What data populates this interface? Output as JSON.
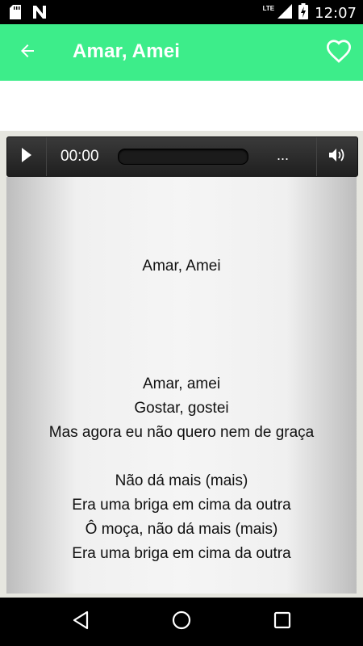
{
  "status_bar": {
    "network": "LTE",
    "time": "12:07",
    "icons": [
      "sd-card-icon",
      "n-notification-icon",
      "signal-icon",
      "battery-charging-icon"
    ]
  },
  "app_bar": {
    "title": "Amar, Amei",
    "back_icon": "arrow-back-icon",
    "favorite_icon": "heart-outline-icon"
  },
  "player": {
    "current_time": "00:00",
    "duration": "...",
    "progress": 0,
    "play_icon": "play-icon",
    "volume_icon": "volume-icon"
  },
  "lyrics": {
    "title": "Amar, Amei",
    "lines": [
      "Amar, amei",
      "Gostar, gostei",
      "Mas agora eu não quero nem de graça",
      "",
      "Não dá mais (mais)",
      "Era uma briga em cima da outra",
      "Ô moça, não dá mais (mais)",
      "Era uma briga em cima da outra"
    ]
  },
  "nav_bar": {
    "icons": [
      "back-triangle-icon",
      "home-circle-icon",
      "recents-square-icon"
    ]
  },
  "colors": {
    "accent": "#3ded8a",
    "status_bar": "#000000",
    "player": "#2a2a2a"
  }
}
